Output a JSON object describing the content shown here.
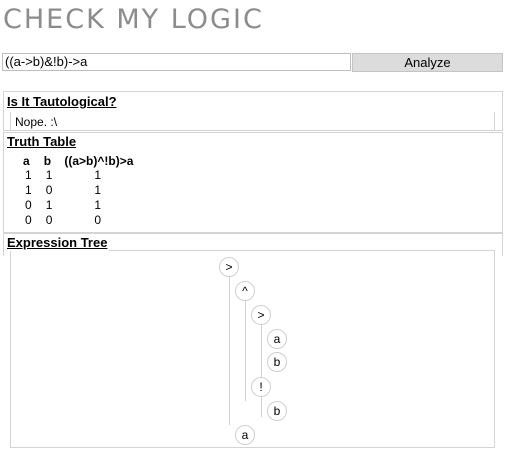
{
  "app": {
    "title": "CHECK MY LOGIC"
  },
  "input": {
    "value": "((a->b)&!b)->a"
  },
  "analyze_button": {
    "label": "Analyze"
  },
  "tautology": {
    "heading": "Is It Tautological?",
    "result": "Nope. :\\"
  },
  "truth_table": {
    "heading": "Truth Table",
    "columns": [
      "a",
      "b",
      "((a>b)^!b)>a"
    ],
    "rows": [
      [
        "1",
        "1",
        "1"
      ],
      [
        "1",
        "0",
        "1"
      ],
      [
        "0",
        "1",
        "1"
      ],
      [
        "0",
        "0",
        "0"
      ]
    ]
  },
  "expression_tree": {
    "heading": "Expression Tree",
    "nodes": [
      ">",
      "^",
      ">",
      "a",
      "b",
      "!",
      "b",
      "a"
    ]
  }
}
